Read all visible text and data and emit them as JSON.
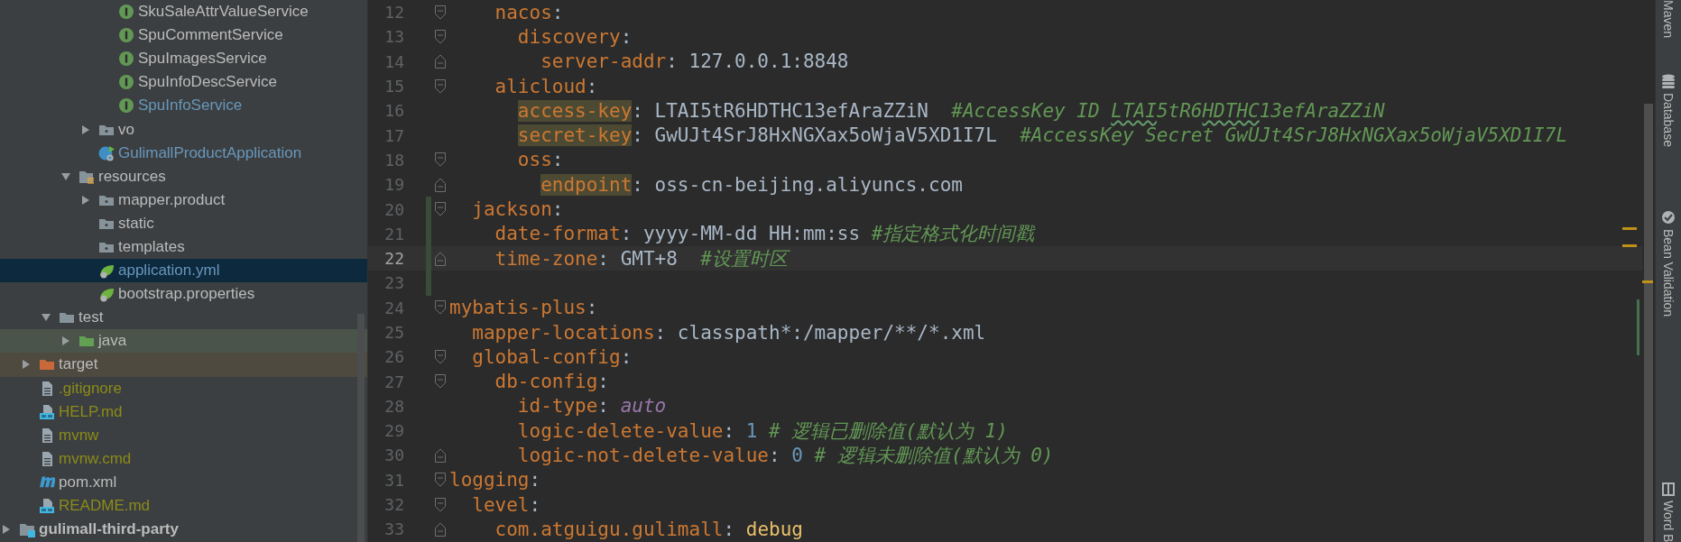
{
  "project_tree": [
    {
      "children": [
        {
          "children": [
            {
              "children": [
                {
                  "children": [
                    {
                      "children": [
                        {
                          "children": [
                            {
                              "label": "SkuSaleAttrValueService",
                              "kind": "interface",
                              "selected": false,
                              "color": "#bbbbbb"
                            },
                            {
                              "label": "SpuCommentService",
                              "kind": "interface",
                              "selected": false,
                              "color": "#bbbbbb"
                            },
                            {
                              "label": "SpuImagesService",
                              "kind": "interface",
                              "selected": false,
                              "color": "#bbbbbb"
                            },
                            {
                              "label": "SpuInfoDescService",
                              "kind": "interface",
                              "selected": false,
                              "color": "#bbbbbb"
                            },
                            {
                              "label": "SpuInfoService",
                              "kind": "interface",
                              "selected": false,
                              "color": "#6897bb"
                            }
                          ]
                        },
                        {
                          "label": "vo",
                          "kind": "package",
                          "expanded": false,
                          "selected": false,
                          "color": "#bbbbbb"
                        },
                        {
                          "label": "GulimallProductApplication",
                          "kind": "spring-app",
                          "selected": false,
                          "color": "#6897bb"
                        }
                      ]
                    },
                    {
                      "label": "resources",
                      "kind": "resources-folder",
                      "expanded": true,
                      "selected": false,
                      "color": "#bbbbbb",
                      "children": [
                        {
                          "label": "mapper.product",
                          "kind": "package",
                          "expanded": false,
                          "selected": false,
                          "color": "#bbbbbb"
                        },
                        {
                          "label": "static",
                          "kind": "package",
                          "selected": false,
                          "color": "#bbbbbb"
                        },
                        {
                          "label": "templates",
                          "kind": "package",
                          "selected": false,
                          "color": "#bbbbbb"
                        },
                        {
                          "label": "application.yml",
                          "kind": "spring-config",
                          "selected": true,
                          "color": "#6897bb"
                        },
                        {
                          "label": "bootstrap.properties",
                          "kind": "spring-config",
                          "selected": false,
                          "color": "#bbbbbb"
                        }
                      ]
                    }
                  ]
                },
                {
                  "label": "test",
                  "kind": "folder",
                  "expanded": true,
                  "selected": false,
                  "color": "#bbbbbb",
                  "children": [
                    {
                      "label": "java",
                      "kind": "test-folder",
                      "expanded": false,
                      "selected": false,
                      "color": "#bbbbbb"
                    }
                  ]
                }
              ]
            },
            {
              "label": "target",
              "kind": "excluded-folder",
              "expanded": false,
              "selected": false,
              "color": "#bbbbbb"
            },
            {
              "label": ".gitignore",
              "kind": "text-file",
              "selected": false,
              "color": "#8b8b18"
            },
            {
              "label": "HELP.md",
              "kind": "markdown-file",
              "selected": false,
              "color": "#8b8b18"
            },
            {
              "label": "mvnw",
              "kind": "text-file",
              "selected": false,
              "color": "#8b8b18"
            },
            {
              "label": "mvnw.cmd",
              "kind": "text-file",
              "selected": false,
              "color": "#8b8b18"
            },
            {
              "label": "pom.xml",
              "kind": "maven-file",
              "selected": false,
              "color": "#bbbbbb"
            },
            {
              "label": "README.md",
              "kind": "markdown-file",
              "selected": false,
              "color": "#8b8b18"
            }
          ]
        },
        {
          "label": "gulimall-third-party",
          "kind": "module",
          "expanded": false,
          "selected": false,
          "color": "#bbbbbb"
        }
      ]
    }
  ],
  "editor": {
    "lines": [
      {
        "children": [
          {
            "children": [
              {
                "number": "12",
                "current": false,
                "changed": false,
                "segments": [
                  {
                    "kind": "key",
                    "text": "nacos"
                  },
                  {
                    "kind": "plain",
                    "text": ":"
                  }
                ],
                "children": [
                  {
                    "number": "13",
                    "current": false,
                    "changed": false,
                    "segments": [
                      {
                        "kind": "key",
                        "text": "discovery"
                      },
                      {
                        "kind": "plain",
                        "text": ":"
                      }
                    ],
                    "children": [
                      {
                        "number": "14",
                        "current": false,
                        "changed": false,
                        "segments": [
                          {
                            "kind": "key",
                            "text": "server-addr"
                          },
                          {
                            "kind": "plain",
                            "text": ": 127.0.0.1:8848"
                          }
                        ]
                      }
                    ]
                  }
                ]
              },
              {
                "number": "15",
                "current": false,
                "changed": false,
                "segments": [
                  {
                    "kind": "key",
                    "text": "alicloud"
                  },
                  {
                    "kind": "plain",
                    "text": ":"
                  }
                ],
                "children": [
                  {
                    "number": "16",
                    "current": false,
                    "changed": false,
                    "segments": [
                      {
                        "kind": "key",
                        "text": "access-key",
                        "highlight": true
                      },
                      {
                        "kind": "plain",
                        "text": ": LTAI5tR6HDTHC13efAraZZiN  "
                      },
                      {
                        "kind": "comment",
                        "text": "#AccessKey ID "
                      },
                      {
                        "kind": "comment",
                        "text": "LTAI",
                        "typo": true
                      },
                      {
                        "kind": "comment",
                        "text": "5tR6"
                      },
                      {
                        "kind": "comment",
                        "text": "HDTHC",
                        "typo": true
                      },
                      {
                        "kind": "comment",
                        "text": "13efAraZZiN"
                      }
                    ]
                  },
                  {
                    "number": "17",
                    "current": false,
                    "changed": false,
                    "segments": [
                      {
                        "kind": "key",
                        "text": "secret-key",
                        "highlight": true
                      },
                      {
                        "kind": "plain",
                        "text": ": GwUJt4SrJ8HxNGXax5oWjaV5XD1I7L  "
                      },
                      {
                        "kind": "comment",
                        "text": "#AccessKey Secret GwUJt4SrJ8HxNGXax5oWjaV5XD1I7L"
                      }
                    ]
                  },
                  {
                    "number": "18",
                    "current": false,
                    "changed": false,
                    "segments": [
                      {
                        "kind": "key",
                        "text": "oss"
                      },
                      {
                        "kind": "plain",
                        "text": ":"
                      }
                    ],
                    "children": [
                      {
                        "number": "19",
                        "current": false,
                        "changed": false,
                        "segments": [
                          {
                            "kind": "key",
                            "text": "endpoint",
                            "highlight": true
                          },
                          {
                            "kind": "plain",
                            "text": ": oss-cn-beijing.aliyuncs.com"
                          }
                        ]
                      }
                    ]
                  }
                ]
              }
            ]
          },
          {
            "number": "20",
            "current": false,
            "changed": true,
            "segments": [
              {
                "kind": "key",
                "text": "jackson"
              },
              {
                "kind": "plain",
                "text": ":"
              }
            ],
            "children": [
              {
                "number": "21",
                "current": false,
                "changed": true,
                "segments": [
                  {
                    "kind": "key",
                    "text": "date-format"
                  },
                  {
                    "kind": "plain",
                    "text": ": yyyy-MM-dd HH:mm:ss "
                  },
                  {
                    "kind": "comment",
                    "text": "#指定格式化时间戳"
                  }
                ]
              },
              {
                "number": "22",
                "current": true,
                "changed": true,
                "segments": [
                  {
                    "kind": "key",
                    "text": "time-zone"
                  },
                  {
                    "kind": "plain",
                    "text": ": GMT+8  "
                  },
                  {
                    "kind": "comment",
                    "text": "#设置时区"
                  }
                ]
              }
            ]
          }
        ]
      },
      {
        "number": "23",
        "current": false,
        "changed": true
      },
      {
        "number": "24",
        "current": false,
        "changed": false,
        "segments": [
          {
            "kind": "key",
            "text": "mybatis-plus"
          },
          {
            "kind": "plain",
            "text": ":"
          }
        ],
        "children": [
          {
            "number": "25",
            "current": false,
            "changed": false,
            "segments": [
              {
                "kind": "key",
                "text": "mapper-locations"
              },
              {
                "kind": "plain",
                "text": ": classpath*:/mapper/**/*.xml"
              }
            ]
          },
          {
            "number": "26",
            "current": false,
            "changed": false,
            "segments": [
              {
                "kind": "key",
                "text": "global-config"
              },
              {
                "kind": "plain",
                "text": ":"
              }
            ],
            "children": [
              {
                "number": "27",
                "current": false,
                "changed": false,
                "segments": [
                  {
                    "kind": "key",
                    "text": "db-config"
                  },
                  {
                    "kind": "plain",
                    "text": ":"
                  }
                ],
                "children": [
                  {
                    "number": "28",
                    "current": false,
                    "changed": false,
                    "segments": [
                      {
                        "kind": "key",
                        "text": "id-type"
                      },
                      {
                        "kind": "plain",
                        "text": ": "
                      },
                      {
                        "kind": "keyword",
                        "text": "auto"
                      }
                    ]
                  },
                  {
                    "number": "29",
                    "current": false,
                    "changed": false,
                    "segments": [
                      {
                        "kind": "key",
                        "text": "logic-delete-value"
                      },
                      {
                        "kind": "plain",
                        "text": ": "
                      },
                      {
                        "kind": "number",
                        "text": "1"
                      },
                      {
                        "kind": "comment",
                        "text": " # 逻辑已删除值(默认为 1)"
                      }
                    ]
                  },
                  {
                    "number": "30",
                    "current": false,
                    "changed": false,
                    "segments": [
                      {
                        "kind": "key",
                        "text": "logic-not-delete-value"
                      },
                      {
                        "kind": "plain",
                        "text": ": "
                      },
                      {
                        "kind": "number",
                        "text": "0"
                      },
                      {
                        "kind": "comment",
                        "text": " # 逻辑未删除值(默认为 0)"
                      }
                    ]
                  }
                ]
              }
            ]
          }
        ]
      },
      {
        "number": "31",
        "current": false,
        "changed": false,
        "segments": [
          {
            "kind": "key",
            "text": "logging"
          },
          {
            "kind": "plain",
            "text": ":"
          }
        ],
        "children": [
          {
            "number": "32",
            "current": false,
            "changed": false,
            "segments": [
              {
                "kind": "key",
                "text": "level"
              },
              {
                "kind": "plain",
                "text": ":"
              }
            ],
            "children": [
              {
                "number": "33",
                "current": false,
                "changed": false,
                "segments": [
                  {
                    "kind": "key",
                    "text": "com.atguigu.gulimall"
                  },
                  {
                    "kind": "plain",
                    "text": ": "
                  },
                  {
                    "kind": "string",
                    "text": "debug"
                  }
                ]
              }
            ]
          }
        ]
      }
    ]
  },
  "tool_windows": {
    "top": [
      {
        "label": "Maven",
        "kind": "maven"
      },
      {
        "label": "Database",
        "kind": "database"
      },
      {
        "label": "Bean Validation",
        "kind": "bean"
      }
    ],
    "bottom": [
      {
        "label": "Word B",
        "kind": "book"
      }
    ]
  }
}
